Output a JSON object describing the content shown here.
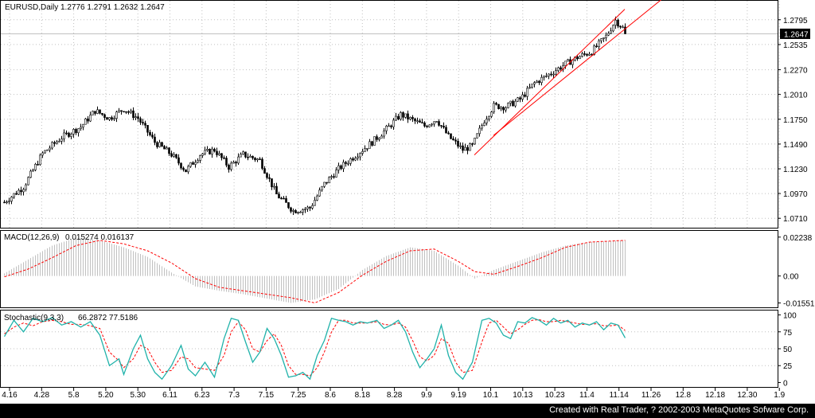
{
  "chart_data": {
    "type": "candlestick",
    "symbol_label": "EURUSD,Daily",
    "ohlc_label": "1.2776 1.2791 1.2632 1.2647",
    "current_price_label": "1.2647",
    "price_axis": {
      "ylim": [
        1.067,
        1.2935
      ],
      "ticks": [
        "1.2795",
        "1.2535",
        "1.2270",
        "1.2010",
        "1.1750",
        "1.1490",
        "1.1230",
        "1.0970",
        "1.0710"
      ]
    },
    "x_axis": {
      "ticks": [
        "4.16",
        "4.28",
        "5.8",
        "5.20",
        "5.30",
        "6.11",
        "6.23",
        "7.3",
        "7.15",
        "7.25",
        "8.6",
        "8.18",
        "8.28",
        "9.9",
        "9.19",
        "10.1",
        "10.13",
        "10.23",
        "11.4",
        "11.14",
        "11.26",
        "12.8",
        "12.18",
        "12.30",
        "1.9"
      ]
    },
    "price_anchors": [
      [
        0,
        1.088
      ],
      [
        8,
        1.104
      ],
      [
        16,
        1.139
      ],
      [
        24,
        1.156
      ],
      [
        32,
        1.167
      ],
      [
        38,
        1.184
      ],
      [
        44,
        1.176
      ],
      [
        50,
        1.186
      ],
      [
        56,
        1.176
      ],
      [
        63,
        1.151
      ],
      [
        70,
        1.138
      ],
      [
        76,
        1.121
      ],
      [
        82,
        1.138
      ],
      [
        88,
        1.143
      ],
      [
        94,
        1.125
      ],
      [
        100,
        1.138
      ],
      [
        107,
        1.132
      ],
      [
        114,
        1.096
      ],
      [
        121,
        1.079
      ],
      [
        128,
        1.082
      ],
      [
        134,
        1.107
      ],
      [
        140,
        1.123
      ],
      [
        147,
        1.137
      ],
      [
        154,
        1.151
      ],
      [
        161,
        1.167
      ],
      [
        166,
        1.18
      ],
      [
        171,
        1.174
      ],
      [
        176,
        1.168
      ],
      [
        181,
        1.175
      ],
      [
        186,
        1.157
      ],
      [
        192,
        1.143
      ],
      [
        196,
        1.147
      ],
      [
        201,
        1.174
      ],
      [
        205,
        1.189
      ],
      [
        210,
        1.188
      ],
      [
        216,
        1.196
      ],
      [
        222,
        1.213
      ],
      [
        228,
        1.222
      ],
      [
        235,
        1.233
      ],
      [
        240,
        1.24
      ],
      [
        246,
        1.246
      ],
      [
        252,
        1.262
      ],
      [
        256,
        1.279
      ],
      [
        260,
        1.268
      ]
    ],
    "channel": [
      {
        "x": [
          197,
          260
        ],
        "y": [
          1.1375,
          1.2905
        ]
      },
      {
        "x": [
          205,
          276
        ],
        "y": [
          1.158,
          1.302
        ]
      }
    ],
    "macd": {
      "label": "MACD(12,26,9)",
      "values_label": "0.015274 0.016137",
      "ticks": [
        "0.02238",
        "0.00",
        "-0.01551"
      ],
      "ylim": [
        -0.0162,
        0.0232
      ],
      "hist_anchors": [
        [
          0,
          0.0015
        ],
        [
          10,
          0.0095
        ],
        [
          20,
          0.0175
        ],
        [
          30,
          0.022
        ],
        [
          40,
          0.0205
        ],
        [
          50,
          0.0165
        ],
        [
          60,
          0.011
        ],
        [
          70,
          0.002
        ],
        [
          80,
          -0.006
        ],
        [
          90,
          -0.0085
        ],
        [
          100,
          -0.0105
        ],
        [
          110,
          -0.013
        ],
        [
          120,
          -0.0155
        ],
        [
          130,
          -0.0135
        ],
        [
          140,
          -0.0075
        ],
        [
          150,
          0.0035
        ],
        [
          160,
          0.0115
        ],
        [
          170,
          0.0165
        ],
        [
          180,
          0.0145
        ],
        [
          190,
          0.006
        ],
        [
          197,
          -0.0015
        ],
        [
          205,
          0.0035
        ],
        [
          215,
          0.0085
        ],
        [
          225,
          0.0135
        ],
        [
          235,
          0.0175
        ],
        [
          245,
          0.0195
        ],
        [
          260,
          0.0205
        ]
      ],
      "signal_anchors": [
        [
          0,
          -0.0005
        ],
        [
          10,
          0.004
        ],
        [
          20,
          0.0105
        ],
        [
          30,
          0.0175
        ],
        [
          40,
          0.0205
        ],
        [
          50,
          0.0185
        ],
        [
          60,
          0.0145
        ],
        [
          70,
          0.0075
        ],
        [
          80,
          -0.0015
        ],
        [
          90,
          -0.0065
        ],
        [
          100,
          -0.0085
        ],
        [
          110,
          -0.0105
        ],
        [
          120,
          -0.0125
        ],
        [
          130,
          -0.0155
        ],
        [
          140,
          -0.0095
        ],
        [
          150,
          0.0005
        ],
        [
          160,
          0.0085
        ],
        [
          170,
          0.0145
        ],
        [
          180,
          0.0155
        ],
        [
          190,
          0.0085
        ],
        [
          197,
          0.0025
        ],
        [
          205,
          0.001
        ],
        [
          215,
          0.0055
        ],
        [
          225,
          0.0105
        ],
        [
          235,
          0.0165
        ],
        [
          245,
          0.0195
        ],
        [
          260,
          0.0205
        ]
      ]
    },
    "stochastic": {
      "label": "Stochastic(9,3,3)",
      "values_label": "66.2872 77.5186",
      "ticks": [
        "100",
        "75",
        "50",
        "25",
        "0"
      ],
      "ylim": [
        -3,
        103
      ],
      "main_anchors": [
        [
          0,
          68
        ],
        [
          4,
          92
        ],
        [
          8,
          75
        ],
        [
          12,
          95
        ],
        [
          16,
          90
        ],
        [
          20,
          96
        ],
        [
          24,
          85
        ],
        [
          28,
          90
        ],
        [
          32,
          82
        ],
        [
          36,
          90
        ],
        [
          40,
          70
        ],
        [
          44,
          25
        ],
        [
          48,
          35
        ],
        [
          50,
          12
        ],
        [
          54,
          50
        ],
        [
          57,
          70
        ],
        [
          60,
          35
        ],
        [
          63,
          15
        ],
        [
          66,
          5
        ],
        [
          70,
          25
        ],
        [
          74,
          55
        ],
        [
          77,
          20
        ],
        [
          80,
          10
        ],
        [
          84,
          30
        ],
        [
          88,
          8
        ],
        [
          92,
          65
        ],
        [
          95,
          95
        ],
        [
          98,
          92
        ],
        [
          101,
          60
        ],
        [
          104,
          30
        ],
        [
          107,
          45
        ],
        [
          110,
          80
        ],
        [
          113,
          65
        ],
        [
          116,
          40
        ],
        [
          119,
          8
        ],
        [
          122,
          10
        ],
        [
          125,
          15
        ],
        [
          128,
          5
        ],
        [
          131,
          40
        ],
        [
          134,
          62
        ],
        [
          137,
          95
        ],
        [
          140,
          92
        ],
        [
          143,
          90
        ],
        [
          146,
          85
        ],
        [
          149,
          90
        ],
        [
          152,
          88
        ],
        [
          156,
          92
        ],
        [
          159,
          80
        ],
        [
          162,
          85
        ],
        [
          165,
          92
        ],
        [
          168,
          75
        ],
        [
          171,
          45
        ],
        [
          174,
          22
        ],
        [
          177,
          35
        ],
        [
          180,
          50
        ],
        [
          183,
          85
        ],
        [
          186,
          40
        ],
        [
          189,
          15
        ],
        [
          192,
          5
        ],
        [
          196,
          30
        ],
        [
          200,
          92
        ],
        [
          203,
          95
        ],
        [
          206,
          88
        ],
        [
          209,
          70
        ],
        [
          212,
          65
        ],
        [
          215,
          90
        ],
        [
          218,
          88
        ],
        [
          221,
          96
        ],
        [
          224,
          92
        ],
        [
          227,
          85
        ],
        [
          230,
          95
        ],
        [
          233,
          88
        ],
        [
          236,
          92
        ],
        [
          239,
          82
        ],
        [
          242,
          88
        ],
        [
          245,
          85
        ],
        [
          248,
          90
        ],
        [
          251,
          78
        ],
        [
          254,
          88
        ],
        [
          257,
          85
        ],
        [
          260,
          66
        ]
      ],
      "signal_anchors": [
        [
          0,
          72
        ],
        [
          4,
          82
        ],
        [
          8,
          88
        ],
        [
          12,
          84
        ],
        [
          16,
          90
        ],
        [
          20,
          92
        ],
        [
          24,
          90
        ],
        [
          28,
          86
        ],
        [
          32,
          86
        ],
        [
          36,
          84
        ],
        [
          40,
          80
        ],
        [
          44,
          45
        ],
        [
          48,
          32
        ],
        [
          50,
          22
        ],
        [
          54,
          35
        ],
        [
          57,
          55
        ],
        [
          60,
          50
        ],
        [
          63,
          30
        ],
        [
          66,
          15
        ],
        [
          70,
          18
        ],
        [
          74,
          38
        ],
        [
          77,
          35
        ],
        [
          80,
          22
        ],
        [
          84,
          20
        ],
        [
          88,
          18
        ],
        [
          92,
          40
        ],
        [
          95,
          75
        ],
        [
          98,
          90
        ],
        [
          101,
          78
        ],
        [
          104,
          50
        ],
        [
          107,
          45
        ],
        [
          110,
          62
        ],
        [
          113,
          72
        ],
        [
          116,
          55
        ],
        [
          119,
          25
        ],
        [
          122,
          12
        ],
        [
          125,
          12
        ],
        [
          128,
          10
        ],
        [
          131,
          22
        ],
        [
          134,
          45
        ],
        [
          137,
          75
        ],
        [
          140,
          92
        ],
        [
          143,
          92
        ],
        [
          146,
          88
        ],
        [
          149,
          88
        ],
        [
          152,
          88
        ],
        [
          156,
          90
        ],
        [
          159,
          86
        ],
        [
          162,
          85
        ],
        [
          165,
          88
        ],
        [
          168,
          82
        ],
        [
          171,
          62
        ],
        [
          174,
          38
        ],
        [
          177,
          32
        ],
        [
          180,
          40
        ],
        [
          183,
          65
        ],
        [
          186,
          58
        ],
        [
          189,
          30
        ],
        [
          192,
          15
        ],
        [
          196,
          18
        ],
        [
          200,
          60
        ],
        [
          203,
          88
        ],
        [
          206,
          92
        ],
        [
          209,
          82
        ],
        [
          212,
          72
        ],
        [
          215,
          78
        ],
        [
          218,
          86
        ],
        [
          221,
          92
        ],
        [
          224,
          93
        ],
        [
          227,
          90
        ],
        [
          230,
          90
        ],
        [
          233,
          92
        ],
        [
          236,
          90
        ],
        [
          239,
          88
        ],
        [
          242,
          86
        ],
        [
          245,
          86
        ],
        [
          248,
          87
        ],
        [
          251,
          84
        ],
        [
          254,
          84
        ],
        [
          257,
          85
        ],
        [
          260,
          77
        ]
      ]
    },
    "colors": {
      "bull": "#ffffff",
      "bear": "#000000",
      "wick": "#000000",
      "channel": "#ff0000",
      "macd_hist": "#c0c0c0",
      "macd_signal": "#ff0000",
      "stoch_main": "#20b2aa",
      "stoch_signal": "#ff0000",
      "grid": "#c0c0c0",
      "current_line": "#c0c0c0"
    },
    "grid": true
  },
  "footer": {
    "credit": "Created with Real Trader, ? 2002-2003 MetaQuotes Sofware Corp."
  }
}
